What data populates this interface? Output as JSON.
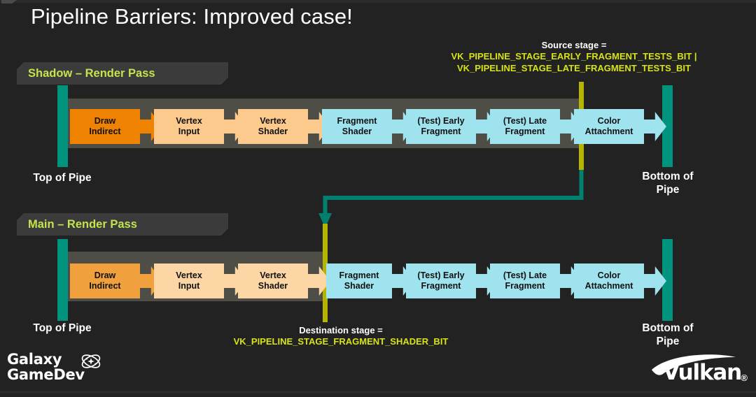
{
  "slide": {
    "title": "Pipeline Barriers: Improved case!",
    "background_color": "#222222"
  },
  "colors": {
    "accent_green": "#c3e34f",
    "annotation_yellow": "#d7e317",
    "barrier_yellow": "#b5b500",
    "pipe_teal": "#00947e",
    "band_gray": "#4e4e47",
    "banner_gray": "#3b3b3b",
    "box_orange_strong": "#ef8200",
    "box_orange_light": "#fcca8d",
    "box_cyan": "#9fe3ee",
    "box_text": "#111111"
  },
  "annotations": {
    "source": {
      "head": "Source stage =",
      "line1": "VK_PIPELINE_STAGE_EARLY_FRAGMENT_TESTS_BIT |",
      "line2": "VK_PIPELINE_STAGE_LATE_FRAGMENT_TESTS_BIT"
    },
    "destination": {
      "head": "Destination stage =",
      "line1": "VK_PIPELINE_STAGE_FRAGMENT_SHADER_BIT"
    }
  },
  "pipelines": [
    {
      "id": "shadow",
      "banner": "Shadow – Render Pass",
      "top_label": "Top of Pipe",
      "bottom_label": "Bottom of\nPipe",
      "bottom_label_line1": "Bottom of",
      "bottom_label_line2": "Pipe",
      "stages": [
        {
          "line1": "Draw",
          "line2": "Indirect",
          "color": "#ef8200"
        },
        {
          "line1": "Vertex",
          "line2": "Input",
          "color": "#fcca8d"
        },
        {
          "line1": "Vertex",
          "line2": "Shader",
          "color": "#fcca8d"
        },
        {
          "line1": "Fragment",
          "line2": "Shader",
          "color": "#9fe3ee"
        },
        {
          "line1": "(Test) Early",
          "line2": "Fragment",
          "color": "#9fe3ee"
        },
        {
          "line1": "(Test) Late",
          "line2": "Fragment",
          "color": "#9fe3ee"
        },
        {
          "line1": "Color",
          "line2": "Attachment",
          "color": "#9fe3ee"
        }
      ]
    },
    {
      "id": "main",
      "banner": "Main – Render Pass",
      "top_label": "Top of Pipe",
      "bottom_label_line1": "Bottom of",
      "bottom_label_line2": "Pipe",
      "stages": [
        {
          "line1": "Draw",
          "line2": "Indirect",
          "color": "#f0a03c"
        },
        {
          "line1": "Vertex",
          "line2": "Input",
          "color": "#fcd6a4"
        },
        {
          "line1": "Vertex",
          "line2": "Shader",
          "color": "#fcd6a4"
        },
        {
          "line1": "Fragment",
          "line2": "Shader",
          "color": "#9fe3ee"
        },
        {
          "line1": "(Test) Early",
          "line2": "Fragment",
          "color": "#9fe3ee"
        },
        {
          "line1": "(Test) Late",
          "line2": "Fragment",
          "color": "#9fe3ee"
        },
        {
          "line1": "Color",
          "line2": "Attachment",
          "color": "#9fe3ee"
        }
      ]
    }
  ],
  "logos": {
    "galaxy": {
      "line1": "Galaxy",
      "line2": "GameDev",
      "icon": "atom-icon"
    },
    "vulkan": {
      "word": "Vulkan",
      "mark": "®"
    }
  }
}
